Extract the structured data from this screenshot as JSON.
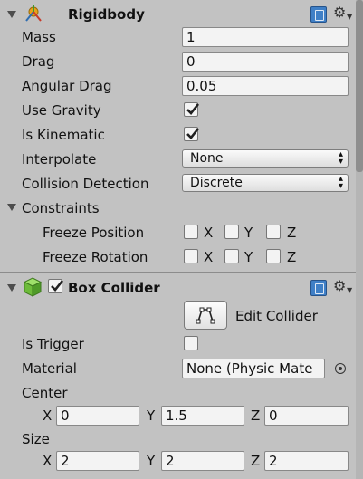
{
  "rigidbody": {
    "title": "Rigidbody",
    "icon": "rigidbody-icon",
    "fields": {
      "mass": {
        "label": "Mass",
        "value": "1"
      },
      "drag": {
        "label": "Drag",
        "value": "0"
      },
      "angular_drag": {
        "label": "Angular Drag",
        "value": "0.05"
      },
      "use_gravity": {
        "label": "Use Gravity",
        "checked": true
      },
      "is_kinematic": {
        "label": "Is Kinematic",
        "checked": true
      },
      "interpolate": {
        "label": "Interpolate",
        "value": "None"
      },
      "collision_detection": {
        "label": "Collision Detection",
        "value": "Discrete"
      }
    },
    "constraints": {
      "label": "Constraints",
      "freeze_position": {
        "label": "Freeze Position",
        "axes": [
          "X",
          "Y",
          "Z"
        ]
      },
      "freeze_rotation": {
        "label": "Freeze Rotation",
        "axes": [
          "X",
          "Y",
          "Z"
        ]
      }
    }
  },
  "box_collider": {
    "title": "Box Collider",
    "enabled": true,
    "icon": "box-collider-icon",
    "edit_collider_label": "Edit Collider",
    "is_trigger": {
      "label": "Is Trigger",
      "checked": false
    },
    "material": {
      "label": "Material",
      "value": "None (Physic Mate"
    },
    "center": {
      "label": "Center",
      "x": "0",
      "y": "1.5",
      "z": "0"
    },
    "size": {
      "label": "Size",
      "x": "2",
      "y": "2",
      "z": "2"
    },
    "axis_labels": {
      "x": "X",
      "y": "Y",
      "z": "Z"
    }
  },
  "colors": {
    "panel_bg": "#c2c2c2",
    "help_blue": "#3f7fc6",
    "collider_green": "#6dbb3a"
  }
}
